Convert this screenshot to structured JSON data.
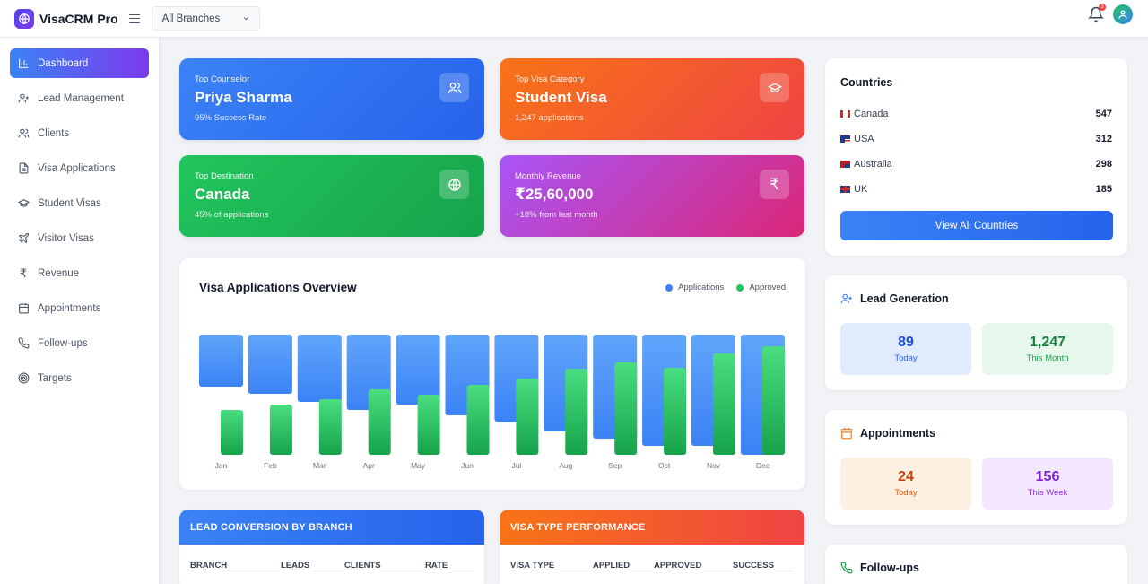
{
  "app": {
    "name": "VisaCRM Pro"
  },
  "header": {
    "branch_select": "All Branches",
    "notification_count": "3"
  },
  "sidebar": {
    "items": [
      {
        "label": "Dashboard",
        "icon": "bar-chart-icon"
      },
      {
        "label": "Lead Management",
        "icon": "user-plus-icon"
      },
      {
        "label": "Clients",
        "icon": "users-icon"
      },
      {
        "label": "Visa Applications",
        "icon": "document-icon"
      },
      {
        "label": "Student Visas",
        "icon": "graduation-cap-icon"
      },
      {
        "label": "Visitor Visas",
        "icon": "plane-icon"
      },
      {
        "label": "Revenue",
        "icon": "rupee-icon"
      },
      {
        "label": "Appointments",
        "icon": "calendar-icon"
      },
      {
        "label": "Follow-ups",
        "icon": "phone-icon"
      },
      {
        "label": "Targets",
        "icon": "target-icon"
      }
    ]
  },
  "stats": {
    "top_counselor": {
      "label": "Top Counselor",
      "value": "Priya Sharma",
      "sub": "95% Success Rate",
      "icon": "users-icon"
    },
    "top_visa_category": {
      "label": "Top Visa Category",
      "value": "Student Visa",
      "sub": "1,247 applications",
      "icon": "graduation-cap-icon"
    },
    "top_destination": {
      "label": "Top Destination",
      "value": "Canada",
      "sub": "45% of applications",
      "icon": "globe-icon"
    },
    "monthly_revenue": {
      "label": "Monthly Revenue",
      "value": "₹25,60,000",
      "sub": "+18% from last month",
      "icon": "rupee-icon"
    }
  },
  "overview": {
    "title": "Visa Applications Overview",
    "legend": {
      "applications": "Applications",
      "approved": "Approved"
    },
    "colors": {
      "applications": "#3b82f6",
      "approved": "#22c55e"
    }
  },
  "chart_data": {
    "type": "bar",
    "title": "Visa Applications Overview",
    "categories": [
      "Jan",
      "Feb",
      "Mar",
      "Apr",
      "May",
      "Jun",
      "Jul",
      "Aug",
      "Sep",
      "Oct",
      "Nov",
      "Dec"
    ],
    "series": [
      {
        "name": "Applications",
        "values": [
          58,
          66,
          75,
          84,
          78,
          90,
          97,
          108,
          116,
          124,
          124,
          134
        ]
      },
      {
        "name": "Approved",
        "values": [
          50,
          56,
          62,
          73,
          67,
          78,
          85,
          96,
          103,
          97,
          113,
          121
        ]
      }
    ],
    "legend_position": "top-right",
    "grid": false
  },
  "lead_conversion": {
    "title": "LEAD CONVERSION BY BRANCH",
    "columns": [
      "BRANCH",
      "LEADS",
      "CLIENTS",
      "RATE"
    ]
  },
  "visa_performance": {
    "title": "VISA TYPE PERFORMANCE",
    "columns": [
      "VISA TYPE",
      "APPLIED",
      "APPROVED",
      "SUCCESS"
    ]
  },
  "countries": {
    "title": "Countries",
    "rows": [
      {
        "name": "Canada",
        "count": "547",
        "flag": "canada-flag-icon"
      },
      {
        "name": "USA",
        "count": "312",
        "flag": "usa-flag-icon"
      },
      {
        "name": "Australia",
        "count": "298",
        "flag": "australia-flag-icon"
      },
      {
        "name": "UK",
        "count": "185",
        "flag": "uk-flag-icon"
      }
    ],
    "button": "View All Countries"
  },
  "lead_generation": {
    "title": "Lead Generation",
    "today": {
      "value": "89",
      "label": "Today"
    },
    "month": {
      "value": "1,247",
      "label": "This Month"
    }
  },
  "appointments": {
    "title": "Appointments",
    "today": {
      "value": "24",
      "label": "Today"
    },
    "week": {
      "value": "156",
      "label": "This Week"
    }
  },
  "followups": {
    "title": "Follow-ups"
  }
}
